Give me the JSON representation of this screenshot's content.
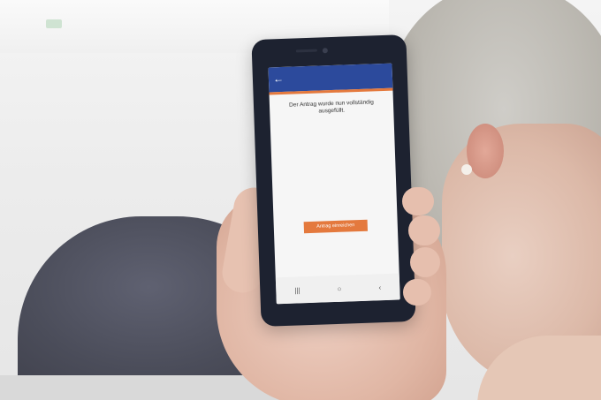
{
  "app": {
    "message": "Der Antrag wurde nun vollständig ausgefüllt.",
    "submit_label": "Antrag einreichen",
    "back_icon": "arrow-left-icon",
    "nav_icons": [
      "recent-apps-icon",
      "home-icon",
      "back-icon"
    ]
  },
  "colors": {
    "appbar": "#2c4a9c",
    "accent": "#e4793d"
  }
}
